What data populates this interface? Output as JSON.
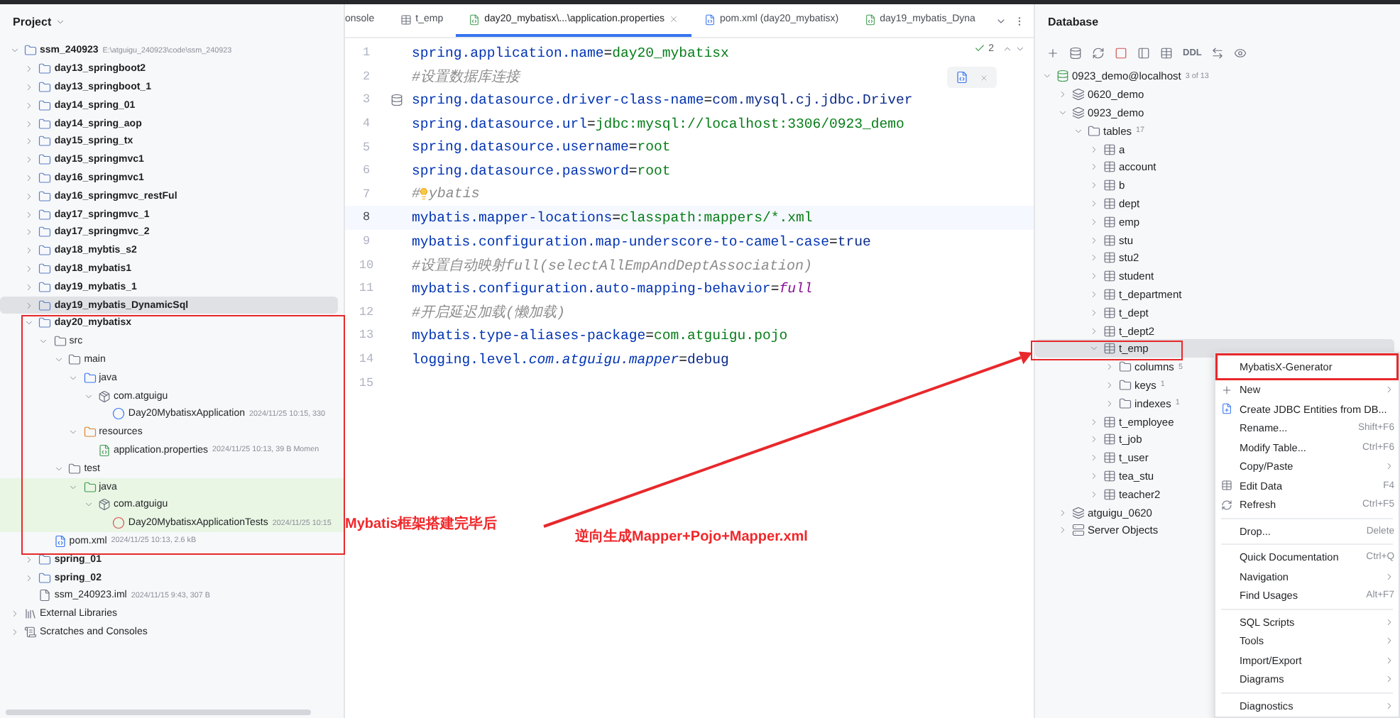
{
  "project_panel": {
    "title": "Project",
    "tree": [
      {
        "label": "ssm_240923",
        "kind": "module",
        "expanded": true,
        "selected": false,
        "meta": "E:\\atguigu_240923\\code\\ssm_240923",
        "children": [
          {
            "label": "day13_springboot2",
            "kind": "module",
            "expanded": false,
            "selected": false
          },
          {
            "label": "day13_springboot_1",
            "kind": "module",
            "expanded": false,
            "selected": false
          },
          {
            "label": "day14_spring_01",
            "kind": "module",
            "expanded": false,
            "selected": false
          },
          {
            "label": "day14_spring_aop",
            "kind": "module",
            "expanded": false,
            "selected": false
          },
          {
            "label": "day15_spring_tx",
            "kind": "module",
            "expanded": false,
            "selected": false
          },
          {
            "label": "day15_springmvc1",
            "kind": "module",
            "expanded": false,
            "selected": false
          },
          {
            "label": "day16_springmvc1",
            "kind": "module",
            "expanded": false,
            "selected": false
          },
          {
            "label": "day16_springmvc_restFul",
            "kind": "module",
            "expanded": false,
            "selected": false
          },
          {
            "label": "day17_springmvc_1",
            "kind": "module",
            "expanded": false,
            "selected": false
          },
          {
            "label": "day17_springmvc_2",
            "kind": "module",
            "expanded": false,
            "selected": false
          },
          {
            "label": "day18_mybtis_s2",
            "kind": "module",
            "expanded": false,
            "selected": false
          },
          {
            "label": "day18_mybatis1",
            "kind": "module",
            "expanded": false,
            "selected": false
          },
          {
            "label": "day19_mybatis_1",
            "kind": "module",
            "expanded": false,
            "selected": false
          },
          {
            "label": "day19_mybatis_DynamicSql",
            "kind": "module",
            "expanded": false,
            "selected": true
          },
          {
            "label": "day20_mybatisx",
            "kind": "module",
            "expanded": true,
            "selected": false,
            "children": [
              {
                "label": "src",
                "kind": "folder",
                "expanded": true,
                "selected": false,
                "children": [
                  {
                    "label": "main",
                    "kind": "folder",
                    "expanded": true,
                    "selected": false,
                    "children": [
                      {
                        "label": "java",
                        "kind": "source",
                        "expanded": true,
                        "selected": false,
                        "children": [
                          {
                            "label": "com.atguigu",
                            "kind": "package",
                            "expanded": true,
                            "selected": false,
                            "children": [
                              {
                                "label": "Day20MybatisxApplication",
                                "kind": "class",
                                "selected": false,
                                "meta": "2024/11/25 10:15, 330"
                              }
                            ]
                          }
                        ]
                      },
                      {
                        "label": "resources",
                        "kind": "resources",
                        "expanded": true,
                        "selected": false,
                        "children": [
                          {
                            "label": "application.properties",
                            "kind": "properties",
                            "selected": false,
                            "meta": "2024/11/25 10:13, 39 B Momen"
                          }
                        ]
                      }
                    ]
                  },
                  {
                    "label": "test",
                    "kind": "folder",
                    "expanded": true,
                    "selected": false,
                    "children": [
                      {
                        "label": "java",
                        "kind": "test",
                        "expanded": true,
                        "selected": false,
                        "test_scope": true,
                        "children": [
                          {
                            "label": "com.atguigu",
                            "kind": "package",
                            "expanded": true,
                            "selected": false,
                            "test_scope": true,
                            "children": [
                              {
                                "label": "Day20MybatisxApplicationTests",
                                "kind": "testclass",
                                "selected": false,
                                "test_scope": true,
                                "meta": "2024/11/25 10:15"
                              }
                            ]
                          }
                        ]
                      }
                    ]
                  }
                ]
              },
              {
                "label": "pom.xml",
                "kind": "maven",
                "selected": false,
                "meta": "2024/11/25 10:13, 2.6 kB"
              }
            ]
          },
          {
            "label": "spring_01",
            "kind": "module",
            "expanded": false,
            "selected": false
          },
          {
            "label": "spring_02",
            "kind": "module",
            "expanded": false,
            "selected": false
          },
          {
            "label": "ssm_240923.iml",
            "kind": "iml",
            "selected": false,
            "meta": "2024/11/15 9:43, 307 B"
          }
        ]
      },
      {
        "label": "External Libraries",
        "kind": "libraries",
        "expanded": false,
        "selected": false
      },
      {
        "label": "Scratches and Consoles",
        "kind": "scratches",
        "expanded": false,
        "selected": false
      }
    ]
  },
  "editor": {
    "tabs": [
      {
        "label": "onsole",
        "kind": "console",
        "selected": false
      },
      {
        "label": "t_emp",
        "kind": "table",
        "selected": false
      },
      {
        "label": "day20_mybatisx\\...\\application.properties",
        "kind": "properties",
        "selected": true
      },
      {
        "label": "pom.xml (day20_mybatisx)",
        "kind": "maven",
        "selected": false
      },
      {
        "label": "day19_mybatis_Dyna",
        "kind": "properties",
        "selected": false
      }
    ],
    "inspection_count": "2",
    "lines": [
      {
        "number": "1",
        "tokens": [
          {
            "text": "spring.application.name",
            "kind": "key"
          },
          {
            "text": "=",
            "kind": "op"
          },
          {
            "text": "day20_mybatisx",
            "kind": "value"
          }
        ]
      },
      {
        "number": "2",
        "tokens": [
          {
            "text": "#设置数据库连接",
            "kind": "comment"
          }
        ]
      },
      {
        "number": "3",
        "gutter_icon": true,
        "tokens": [
          {
            "text": "spring.datasource.driver-class-name",
            "kind": "key"
          },
          {
            "text": "=",
            "kind": "op"
          },
          {
            "text": "com.mysql.cj.jdbc.Driver",
            "kind": "literal"
          }
        ]
      },
      {
        "number": "4",
        "tokens": [
          {
            "text": "spring.datasource.url",
            "kind": "key"
          },
          {
            "text": "=",
            "kind": "op"
          },
          {
            "text": "jdbc:mysql://localhost:3306/0923_demo",
            "kind": "value"
          }
        ]
      },
      {
        "number": "5",
        "tokens": [
          {
            "text": "spring.datasource.username",
            "kind": "key"
          },
          {
            "text": "=",
            "kind": "op"
          },
          {
            "text": "root",
            "kind": "value"
          }
        ]
      },
      {
        "number": "6",
        "tokens": [
          {
            "text": "spring.datasource.password",
            "kind": "key"
          },
          {
            "text": "=",
            "kind": "op"
          },
          {
            "text": "root",
            "kind": "value"
          }
        ]
      },
      {
        "number": "7",
        "tokens": [
          {
            "text": "#",
            "kind": "comment"
          },
          {
            "kind": "bulb"
          },
          {
            "text": "ybatis",
            "kind": "comment"
          }
        ]
      },
      {
        "number": "8",
        "current": true,
        "tokens": [
          {
            "text": "mybatis.mapper-locations",
            "kind": "key"
          },
          {
            "text": "=",
            "kind": "op"
          },
          {
            "text": "classpath:mappers/*.xml",
            "kind": "value"
          }
        ]
      },
      {
        "number": "9",
        "tokens": [
          {
            "text": "mybatis.configuration.map-underscore-to-camel-case",
            "kind": "key"
          },
          {
            "text": "=",
            "kind": "op"
          },
          {
            "text": "true",
            "kind": "literal"
          }
        ]
      },
      {
        "number": "10",
        "tokens": [
          {
            "text": "#设置自动映射full(selectAllEmpAndDeptAssociation)",
            "kind": "comment"
          }
        ]
      },
      {
        "number": "11",
        "tokens": [
          {
            "text": "mybatis.configuration.auto-mapping-behavior",
            "kind": "key"
          },
          {
            "text": "=",
            "kind": "op"
          },
          {
            "text": "full",
            "kind": "constant"
          }
        ]
      },
      {
        "number": "12",
        "tokens": [
          {
            "text": "#开启延迟加载(懒加载)",
            "kind": "comment"
          }
        ]
      },
      {
        "number": "13",
        "tokens": [
          {
            "text": "mybatis.type-aliases-package",
            "kind": "key"
          },
          {
            "text": "=",
            "kind": "op"
          },
          {
            "text": "com.atguigu.pojo",
            "kind": "value"
          }
        ]
      },
      {
        "number": "14",
        "tokens": [
          {
            "text": "logging.level.",
            "kind": "key"
          },
          {
            "text": "com.atguigu.mapper",
            "kind": "package"
          },
          {
            "text": "=",
            "kind": "op"
          },
          {
            "text": "debug",
            "kind": "literal"
          }
        ]
      },
      {
        "number": "15"
      }
    ]
  },
  "database_panel": {
    "title": "Database",
    "ddl_label": "DDL",
    "tree": [
      {
        "label": "0923_demo@localhost",
        "kind": "datasource",
        "expanded": true,
        "selected": false,
        "meta": "3 of 13",
        "children": [
          {
            "label": "0620_demo",
            "kind": "schema",
            "expanded": false,
            "selected": false
          },
          {
            "label": "0923_demo",
            "kind": "schema",
            "expanded": true,
            "selected": false,
            "children": [
              {
                "label": "tables",
                "kind": "folder",
                "expanded": true,
                "selected": false,
                "meta": "17",
                "children": [
                  {
                    "label": "a",
                    "kind": "table",
                    "expanded": false,
                    "selected": false
                  },
                  {
                    "label": "account",
                    "kind": "table",
                    "expanded": false,
                    "selected": false
                  },
                  {
                    "label": "b",
                    "kind": "table",
                    "expanded": false,
                    "selected": false
                  },
                  {
                    "label": "dept",
                    "kind": "table",
                    "expanded": false,
                    "selected": false
                  },
                  {
                    "label": "emp",
                    "kind": "table",
                    "expanded": false,
                    "selected": false
                  },
                  {
                    "label": "stu",
                    "kind": "table",
                    "expanded": false,
                    "selected": false
                  },
                  {
                    "label": "stu2",
                    "kind": "table",
                    "expanded": false,
                    "selected": false
                  },
                  {
                    "label": "student",
                    "kind": "table",
                    "expanded": false,
                    "selected": false
                  },
                  {
                    "label": "t_department",
                    "kind": "table",
                    "expanded": false,
                    "selected": false
                  },
                  {
                    "label": "t_dept",
                    "kind": "table",
                    "expanded": false,
                    "selected": false
                  },
                  {
                    "label": "t_dept2",
                    "kind": "table",
                    "expanded": false,
                    "selected": false
                  },
                  {
                    "label": "t_emp",
                    "kind": "table",
                    "expanded": true,
                    "selected": true,
                    "children": [
                      {
                        "label": "columns",
                        "kind": "folder",
                        "expanded": false,
                        "selected": false,
                        "meta": "5"
                      },
                      {
                        "label": "keys",
                        "kind": "folder",
                        "expanded": false,
                        "selected": false,
                        "meta": "1"
                      },
                      {
                        "label": "indexes",
                        "kind": "folder",
                        "expanded": false,
                        "selected": false,
                        "meta": "1"
                      }
                    ]
                  },
                  {
                    "label": "t_employee",
                    "kind": "table",
                    "expanded": false,
                    "selected": false
                  },
                  {
                    "label": "t_job",
                    "kind": "table",
                    "expanded": false,
                    "selected": false
                  },
                  {
                    "label": "t_user",
                    "kind": "table",
                    "expanded": false,
                    "selected": false
                  },
                  {
                    "label": "tea_stu",
                    "kind": "table",
                    "expanded": false,
                    "selected": false
                  },
                  {
                    "label": "teacher2",
                    "kind": "table",
                    "expanded": false,
                    "selected": false
                  }
                ]
              }
            ]
          },
          {
            "label": "atguigu_0620",
            "kind": "schema",
            "expanded": false,
            "selected": false
          },
          {
            "label": "Server Objects",
            "kind": "server",
            "expanded": false,
            "selected": false
          }
        ]
      }
    ]
  },
  "context_menu": {
    "items": [
      {
        "kind": "item",
        "label": "MybatisX-Generator",
        "annotated": true
      },
      {
        "kind": "new",
        "label": "New",
        "submenu": true
      },
      {
        "kind": "entities",
        "label": "Create JDBC Entities from DB..."
      },
      {
        "kind": "item",
        "label": "Rename...",
        "shortcut": "Shift+F6"
      },
      {
        "kind": "item",
        "label": "Modify Table...",
        "shortcut": "Ctrl+F6"
      },
      {
        "kind": "item",
        "label": "Copy/Paste",
        "submenu": true
      },
      {
        "kind": "table",
        "label": "Edit Data",
        "shortcut": "F4"
      },
      {
        "kind": "refresh",
        "label": "Refresh",
        "shortcut": "Ctrl+F5"
      },
      {
        "kind": "separator"
      },
      {
        "kind": "item",
        "label": "Drop...",
        "shortcut": "Delete"
      },
      {
        "kind": "separator"
      },
      {
        "kind": "item",
        "label": "Quick Documentation",
        "shortcut": "Ctrl+Q"
      },
      {
        "kind": "item",
        "label": "Navigation",
        "submenu": true
      },
      {
        "kind": "item",
        "label": "Find Usages",
        "shortcut": "Alt+F7"
      },
      {
        "kind": "separator"
      },
      {
        "kind": "item",
        "label": "SQL Scripts",
        "submenu": true
      },
      {
        "kind": "item",
        "label": "Tools",
        "submenu": true
      },
      {
        "kind": "item",
        "label": "Import/Export",
        "submenu": true
      },
      {
        "kind": "item",
        "label": "Diagrams",
        "submenu": true
      },
      {
        "kind": "separator"
      },
      {
        "kind": "item",
        "label": "Diagnostics",
        "submenu": true
      }
    ]
  },
  "annotations": [
    {
      "text": "Mybatis框架搭建完毕后"
    },
    {
      "text": "逆向生成Mapper+Pojo+Mapper.xml"
    }
  ]
}
